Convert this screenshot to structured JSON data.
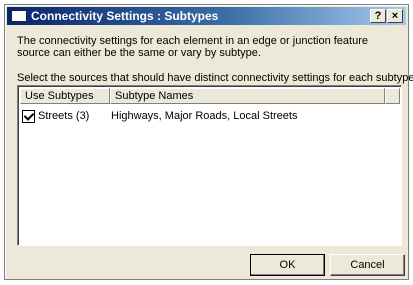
{
  "window": {
    "title": "Connectivity Settings : Subtypes",
    "help_label": "?",
    "close_label": "×"
  },
  "description": "The connectivity settings for each element in an edge or junction feature source can either be the same or vary by subtype.",
  "instruction": "Select the sources that should have distinct connectivity settings for each subtype.",
  "list": {
    "columns": [
      "Use Subtypes",
      "Subtype Names"
    ],
    "rows": [
      {
        "checked": true,
        "source": "Streets (3)",
        "subtypes": "Highways, Major Roads, Local Streets"
      }
    ]
  },
  "buttons": {
    "ok": "OK",
    "cancel": "Cancel"
  },
  "icons": [
    "window-icon",
    "help-icon",
    "close-icon",
    "checkbox-checked-icon"
  ],
  "colors": {
    "title_start": "#0a246a",
    "title_end": "#a6caf0",
    "dialog_bg": "#ece9d8"
  }
}
